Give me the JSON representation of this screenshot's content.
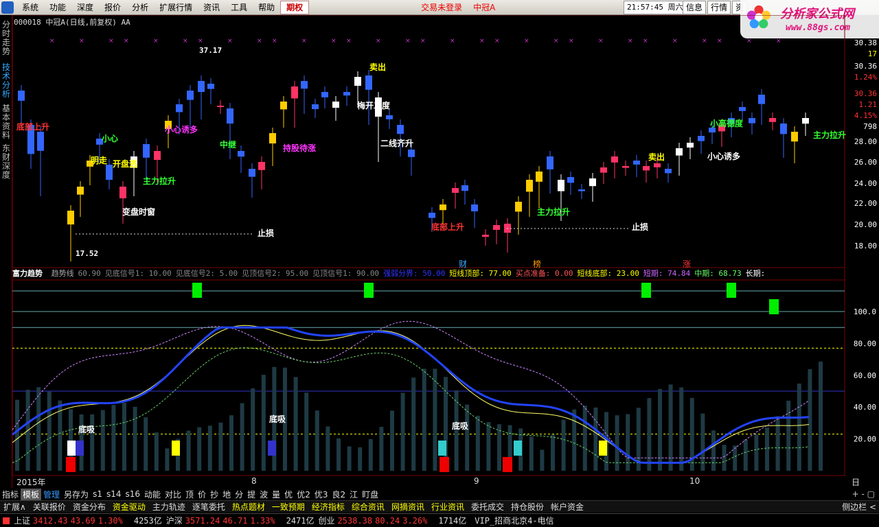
{
  "menu": {
    "items": [
      "系统",
      "功能",
      "深度",
      "报价",
      "分析",
      "扩展行情",
      "资讯",
      "工具",
      "帮助"
    ],
    "active_tab": "期权",
    "status": "交易未登录",
    "stock": "中冠A",
    "clock": "21:57:45 周六",
    "right_buttons": [
      "信息",
      "行情",
      "资"
    ]
  },
  "logo": {
    "title": "分析家公式网",
    "url": "www.88gs.com"
  },
  "left_tabs": [
    "分时走势",
    "技术分析",
    "基本资料",
    "东财深度"
  ],
  "left_active": 1,
  "header": {
    "code_line": "000018 中冠A(日线,前复权) AA"
  },
  "price_axis": [
    "30.38",
    "17",
    "30.36",
    "1.24%",
    "30.36",
    "1.21",
    "4.15%",
    "798",
    "28.00",
    "26.00",
    "24.00",
    "22.00",
    "20.00",
    "18.00"
  ],
  "indicator_axis": [
    "100.0",
    "80.00",
    "60.00",
    "40.00",
    "20.00"
  ],
  "annotations": {
    "high_price": "37.17",
    "low_price": "17.52",
    "stop_loss": "止损",
    "labels": [
      "底部上升",
      "小心",
      "明走",
      "开盘逃",
      "主力拉升",
      "变盘时窗",
      "中继",
      "小心诱多",
      "持股待涨",
      "卖出",
      "梅开二度",
      "二线齐升",
      "底部上升",
      "主力拉升",
      "小高德度",
      "小心诱多",
      "主力拉升",
      "卖出"
    ],
    "markers": [
      "财",
      "榜",
      "涨"
    ]
  },
  "indicator_header": {
    "name": "富力趋势",
    "items": [
      {
        "text": "趋势线",
        "color": "#aaa"
      },
      {
        "text": "60.90",
        "color": "#888"
      },
      {
        "text": "见底信号1: 10.00",
        "color": "#888"
      },
      {
        "text": "见底信号2: 5.00",
        "color": "#888"
      },
      {
        "text": "见顶信号2: 95.00",
        "color": "#888"
      },
      {
        "text": "见顶信号1: 90.00",
        "color": "#888"
      },
      {
        "text": "强弱分界: 50.00",
        "color": "#33f"
      },
      {
        "text": "短线顶部: 77.00",
        "color": "#ff0"
      },
      {
        "text": "买点准备: 0.00",
        "color": "#f55"
      },
      {
        "text": "短线底部: 23.00",
        "color": "#ff0"
      },
      {
        "text": "短期: 74.84",
        "color": "#c6f"
      },
      {
        "text": "中期: 68.73",
        "color": "#6f6"
      },
      {
        "text": "长期:",
        "color": "#fff"
      }
    ],
    "bottom_label": "底吸"
  },
  "date_axis": {
    "labels": [
      "2015年",
      "8",
      "9",
      "10"
    ],
    "unit": "日线"
  },
  "toolbar1": {
    "items": [
      "指标",
      "模板",
      "管理",
      "另存为",
      "s1",
      "s14",
      "s16",
      "动能",
      "对比",
      "顶",
      "价",
      "抄",
      "地",
      "分",
      "提",
      "波",
      "量",
      "优",
      "优2",
      "优3",
      "良2",
      "江",
      "盯盘"
    ],
    "active": 1,
    "highlight": 2,
    "right": "+ - ▢"
  },
  "toolbar2": {
    "items": [
      "扩展∧",
      "关联报价",
      "资金分布",
      "资金驱动",
      "主力轨迹",
      "逐笔委托",
      "热点题材",
      "一致预期",
      "经济指标",
      "综合资讯",
      "网摘资讯",
      "行业资讯",
      "委托成交",
      "持仓股份",
      "帐户资金"
    ],
    "yellow": [
      3,
      6,
      7,
      8,
      9,
      10,
      11
    ],
    "right": "侧边栏 <"
  },
  "statusbar": {
    "sh_label": "上证",
    "sh_index": "3412.43",
    "sh_change": "43.69",
    "sh_pct": "1.30%",
    "sh_amount": "4253亿",
    "hs_label": "沪深",
    "hs_index": "3571.24",
    "hs_change": "46.71",
    "hs_pct": "1.33%",
    "hs_amount": "2471亿",
    "cy_label": "创业",
    "cy_index": "2538.38",
    "cy_change": "80.24",
    "cy_pct": "3.26%",
    "cy_amount": "1714亿",
    "server": "VIP_招商北京4-电信"
  }
}
